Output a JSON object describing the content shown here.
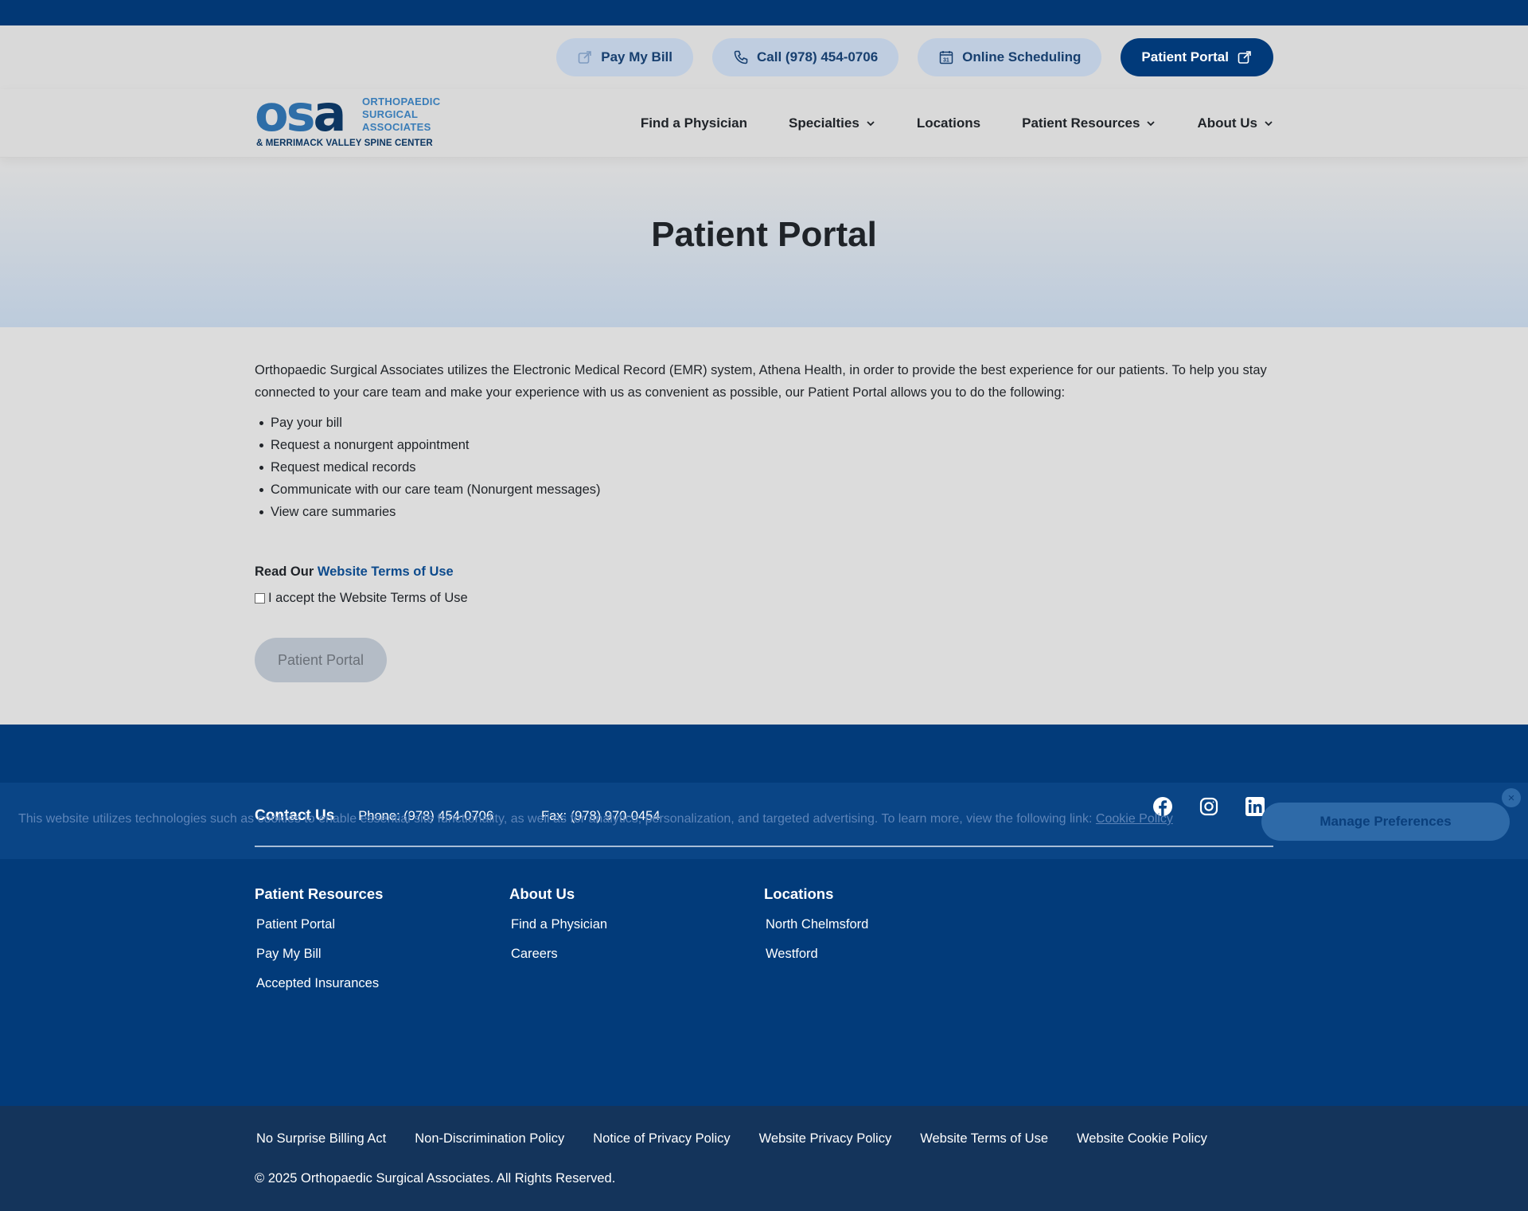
{
  "utility": {
    "pay_bill": "Pay My Bill",
    "call": "Call (978) 454-0706",
    "scheduling": "Online Scheduling",
    "portal": "Patient Portal"
  },
  "logo": {
    "line1": "ORTHOPAEDIC",
    "line2": "SURGICAL",
    "line3": "ASSOCIATES",
    "tagline": "& MERRIMACK VALLEY SPINE CENTER"
  },
  "nav": {
    "find_physician": "Find a Physician",
    "specialties": "Specialties",
    "locations": "Locations",
    "patient_resources": "Patient Resources",
    "about_us": "About Us"
  },
  "hero": {
    "title": "Patient Portal"
  },
  "content": {
    "intro": "Orthopaedic Surgical Associates utilizes the Electronic Medical Record (EMR) system, Athena Health, in order to provide the best experience for our patients. To help you stay connected to your care team and make your experience with us as convenient as possible, our Patient Portal allows you to do the following:",
    "bullets": [
      "Pay your bill",
      "Request a nonurgent appointment",
      "Request medical records",
      "Communicate with our care team (Nonurgent messages)",
      "View care summaries"
    ],
    "read_our": "Read Our ",
    "terms_link": "Website Terms of Use",
    "accept_label": "I accept the Website Terms of Use",
    "portal_button": "Patient Portal"
  },
  "footer": {
    "contact_title": "Contact Us",
    "phone": "Phone: (978) 454-0706",
    "fax": "Fax: (978) 970-0454",
    "columns": [
      {
        "title": "Patient Resources",
        "links": [
          "Patient Portal",
          "Pay My Bill",
          "Accepted Insurances"
        ]
      },
      {
        "title": "About Us",
        "links": [
          "Find a Physician",
          "Careers"
        ]
      },
      {
        "title": "Locations",
        "links": [
          "North Chelmsford",
          "Westford"
        ]
      }
    ]
  },
  "cookie": {
    "text": "This website utilizes technologies such as cookies to enable essential site functionality, as well as for analytics, personalization, and targeted advertising. To learn more, view the following link: ",
    "link": "Cookie Policy",
    "button": "Manage Preferences",
    "close": "×"
  },
  "legal": {
    "links": [
      "No Surprise Billing Act",
      "Non-Discrimination Policy",
      "Notice of Privacy Policy",
      "Website Privacy Policy",
      "Website Terms of Use",
      "Website Cookie Policy"
    ],
    "copyright": "© 2025 Orthopaedic Surgical Associates. All Rights Reserved."
  },
  "colors": {
    "navy": "#023875",
    "pill": "#bfcde0",
    "link": "#0c4a8c",
    "legal_bg": "#14345b"
  },
  "icons": [
    "external-link-icon",
    "phone-icon",
    "calendar-icon",
    "chevron-down-icon",
    "facebook-icon",
    "instagram-icon",
    "linkedin-icon",
    "close-icon"
  ]
}
